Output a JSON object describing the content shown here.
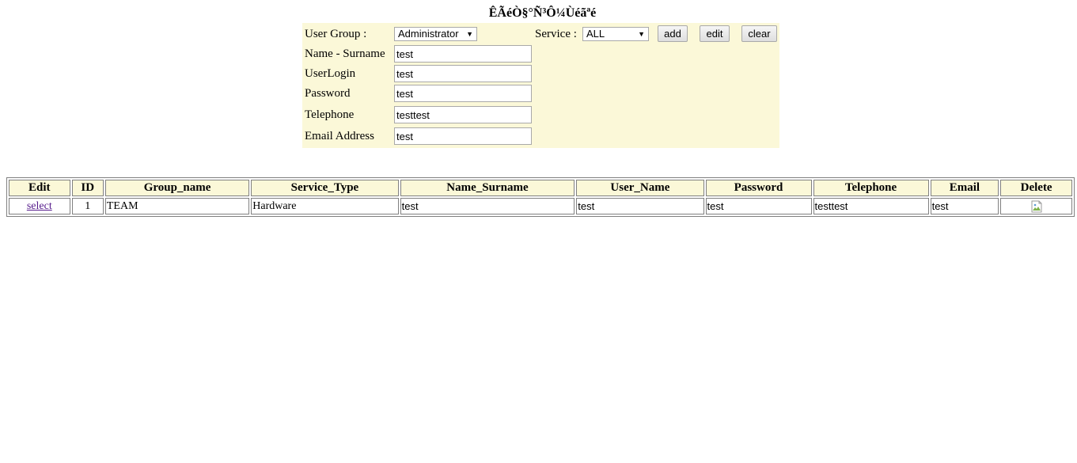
{
  "page": {
    "title": "ÊÃéÒ§°Ñ³Ô¼Ùéãªé"
  },
  "form": {
    "user_group_label": "User Group :",
    "user_group_value": "Administrator",
    "service_label": "Service :",
    "service_value": "ALL",
    "buttons": {
      "add": "add",
      "edit": "edit",
      "clear": "clear"
    },
    "name_label": "Name - Surname",
    "name_value": "test",
    "login_label": "UserLogin",
    "login_value": "test",
    "password_label": "Password",
    "password_value": "test",
    "telephone_label": "Telephone",
    "telephone_value": "testtest",
    "email_label": "Email Address",
    "email_value": "test"
  },
  "table": {
    "headers": [
      "Edit",
      "ID",
      "Group_name",
      "Service_Type",
      "Name_Surname",
      "User_Name",
      "Password",
      "Telephone",
      "Email",
      "Delete"
    ],
    "rows": [
      {
        "edit_link": "select",
        "id": "1",
        "group_name": "TEAM",
        "service_type": "Hardware",
        "name_surname": "test",
        "user_name": "test",
        "password": "test",
        "telephone": "testtest",
        "email": "test",
        "delete_icon": "broken-image-icon"
      }
    ]
  },
  "colors": {
    "panel_bg": "#fbf8d8",
    "link": "#551a8b",
    "border": "#808080"
  }
}
